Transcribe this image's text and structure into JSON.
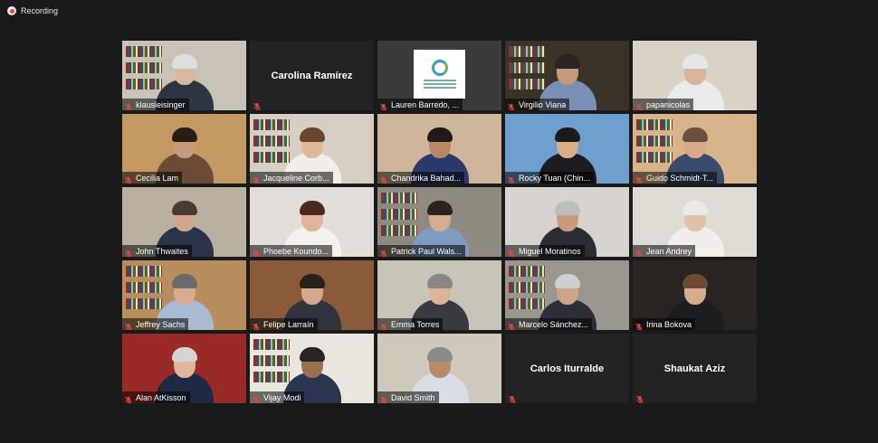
{
  "recording": {
    "label": "Recording"
  },
  "participants": [
    {
      "name": "klausleisinger",
      "video": true,
      "bg": "#c9c3b6",
      "skin": "#d8b8a0",
      "hair": "#dedede",
      "shirt": "#2d3442"
    },
    {
      "name": "Carolina Ramírez",
      "video": false
    },
    {
      "name": "Lauren Barredo, ...",
      "video": true,
      "logo": true,
      "bg": "#3b3b3b"
    },
    {
      "name": "Virgilio Viana",
      "video": true,
      "active": true,
      "bg": "#3a3328",
      "skin": "#c49a7c",
      "hair": "#2a2522",
      "shirt": "#7a8fb5"
    },
    {
      "name": "papanicolas",
      "video": true,
      "bg": "#d9d2c5",
      "skin": "#d8b49a",
      "hair": "#e6e6e6",
      "shirt": "#eaeaea"
    },
    {
      "name": "Cecilia Lam",
      "video": true,
      "bg": "#c59a62",
      "skin": "#c79a7c",
      "hair": "#2b1d16",
      "shirt": "#6b4a36"
    },
    {
      "name": "Jacqueline Corb...",
      "video": true,
      "bg": "#d8cfc4",
      "skin": "#e0b99a",
      "hair": "#6b4530",
      "shirt": "#f2efe9"
    },
    {
      "name": "Chandrika Bahad...",
      "video": true,
      "bg": "#cfb59b",
      "skin": "#b98763",
      "hair": "#1e1a1a",
      "shirt": "#2a3a6a"
    },
    {
      "name": "Rocky Tuan (Chin...",
      "video": true,
      "bg": "#6ea0cf",
      "skin": "#d7b08a",
      "hair": "#1b1b1b",
      "shirt": "#1c1c22"
    },
    {
      "name": "Guido Schmidt-T...",
      "video": true,
      "bg": "#d8b48a",
      "skin": "#d7a98a",
      "hair": "#6a5040",
      "shirt": "#3a4a6a"
    },
    {
      "name": "John Thwaites",
      "video": true,
      "bg": "#b9b0a2",
      "skin": "#d0a78a",
      "hair": "#4a3b33",
      "shirt": "#2a3348"
    },
    {
      "name": "Phoebe Koundo...",
      "video": true,
      "bg": "#e2ddd8",
      "skin": "#e0b49a",
      "hair": "#4a2a1f",
      "shirt": "#f4f1ec"
    },
    {
      "name": "Patrick Paul Wals...",
      "video": true,
      "bg": "#8f8a80",
      "skin": "#d6ac8e",
      "hair": "#2a221e",
      "shirt": "#7f9ac0"
    },
    {
      "name": "Miguel Moratinos",
      "video": true,
      "bg": "#d7d4cf",
      "skin": "#c99a7e",
      "hair": "#bdbdbd",
      "shirt": "#2b2d35"
    },
    {
      "name": "Jean Andrey",
      "video": true,
      "bg": "#dedad4",
      "skin": "#e3c0a8",
      "hair": "#e8e8e8",
      "shirt": "#f1efea"
    },
    {
      "name": "Jeffrey Sachs",
      "video": true,
      "bg": "#b88e5e",
      "skin": "#d7ab8e",
      "hair": "#6a6a6a",
      "shirt": "#a9bad3"
    },
    {
      "name": "Felipe Larraín",
      "video": true,
      "bg": "#8a5a3a",
      "skin": "#d4a88a",
      "hair": "#2a211c",
      "shirt": "#2f3440"
    },
    {
      "name": "Emma Torres",
      "video": true,
      "bg": "#c8c4b8",
      "skin": "#d9b39a",
      "hair": "#8a8784",
      "shirt": "#3a3a40"
    },
    {
      "name": "Marcelo Sánchez...",
      "video": true,
      "bg": "#9a968e",
      "skin": "#cfa488",
      "hair": "#cfcfcf",
      "shirt": "#2d2f38"
    },
    {
      "name": "Irina Bokova",
      "video": true,
      "bg": "#2a2422",
      "skin": "#d6ab8e",
      "hair": "#6e4a34",
      "shirt": "#1e1e22"
    },
    {
      "name": "Alan AtKisson",
      "video": true,
      "bg": "#9a2a28",
      "skin": "#e0b49c",
      "hair": "#d4d4d4",
      "shirt": "#1e2a44"
    },
    {
      "name": "Vijay Modi",
      "video": true,
      "bg": "#e9e6e0",
      "skin": "#9a6f52",
      "hair": "#2a2424",
      "shirt": "#2b3550"
    },
    {
      "name": "David Smith",
      "video": true,
      "bg": "#cfc9bc",
      "skin": "#b98a6c",
      "hair": "#8a8a8a",
      "shirt": "#d8dde6"
    },
    {
      "name": "Carlos Iturralde",
      "video": false
    },
    {
      "name": "Shaukat Aziz",
      "video": false
    }
  ],
  "colors": {
    "background": "#1a1a1a",
    "tile": "#232323",
    "active_border": "#d4e06a",
    "mic_muted": "#e5473d"
  }
}
